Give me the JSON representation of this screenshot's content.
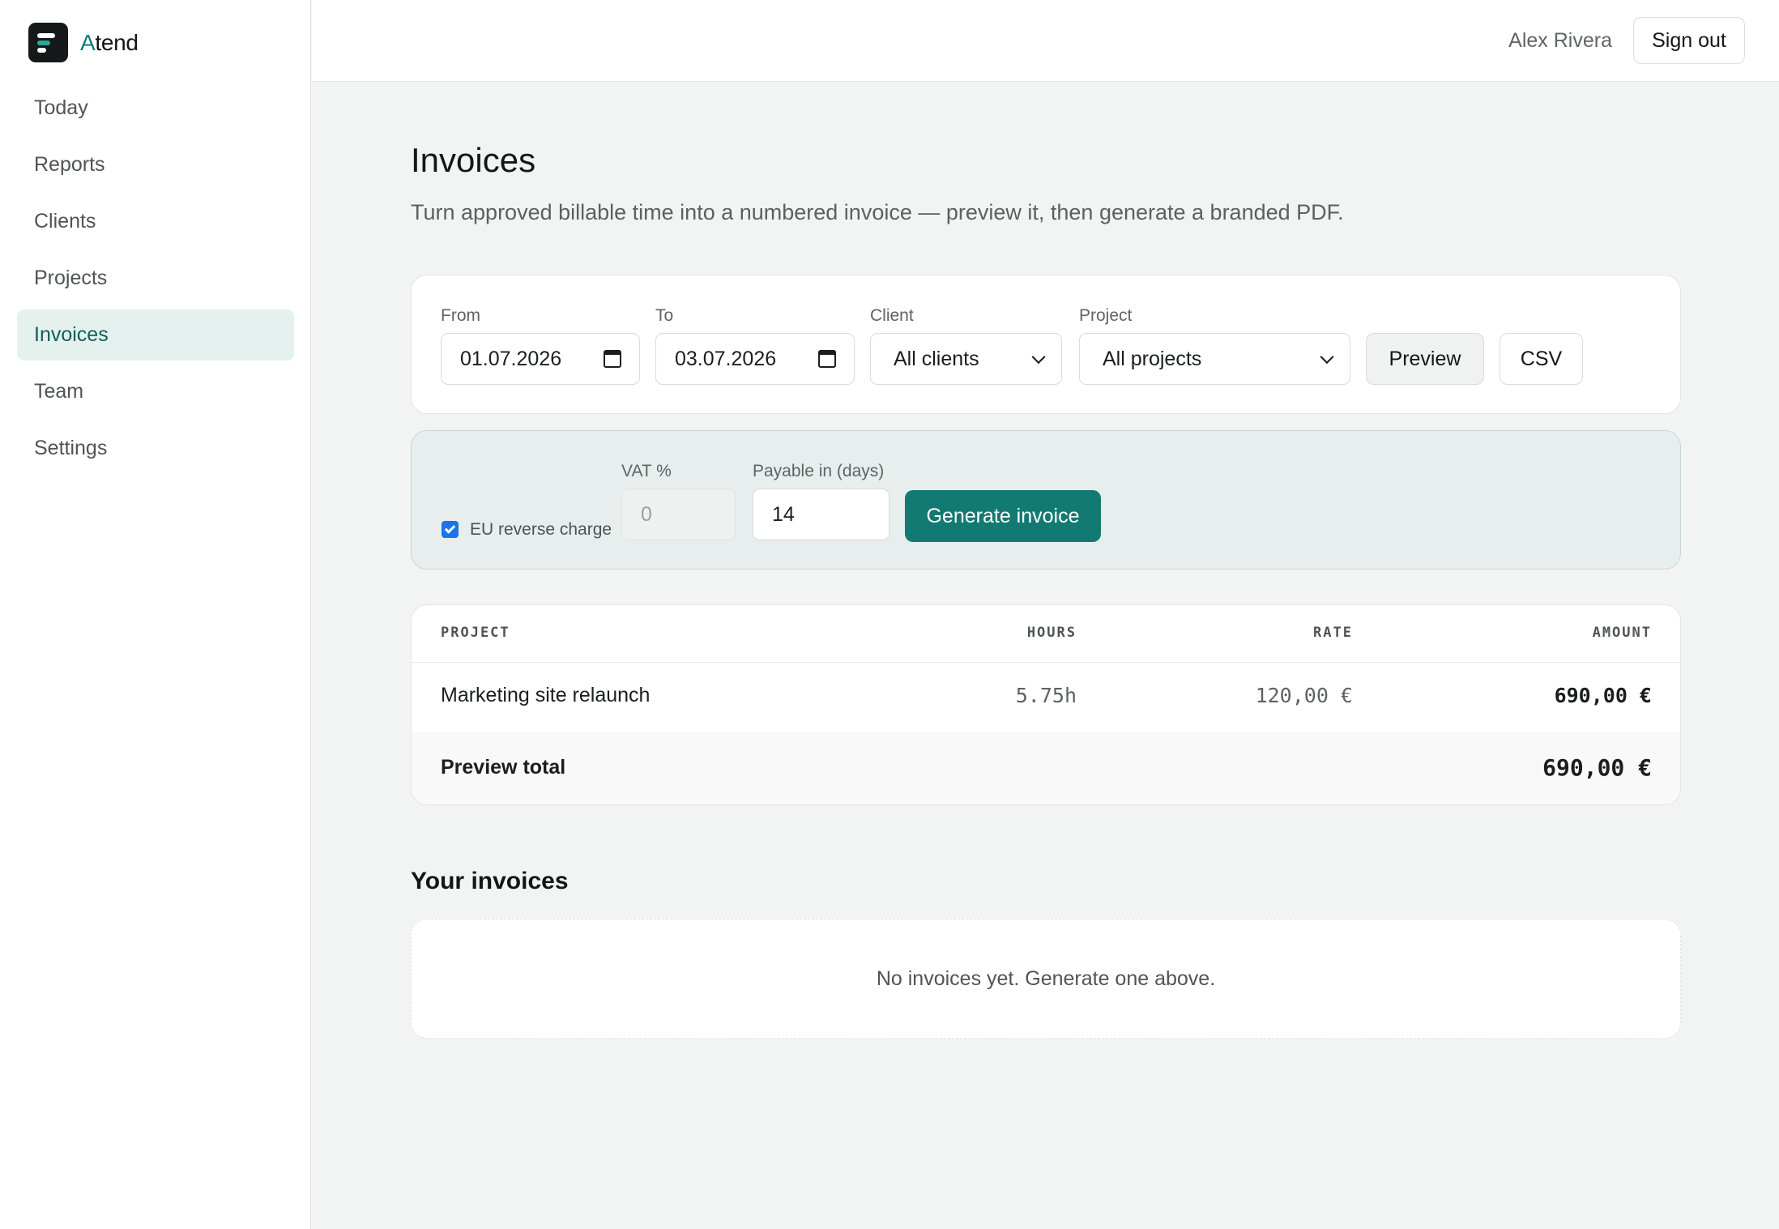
{
  "brand": {
    "name_initial": "A",
    "name_rest": "tend"
  },
  "sidebar": {
    "items": [
      {
        "label": "Today"
      },
      {
        "label": "Reports"
      },
      {
        "label": "Clients"
      },
      {
        "label": "Projects"
      },
      {
        "label": "Invoices",
        "active": true
      },
      {
        "label": "Team"
      },
      {
        "label": "Settings"
      }
    ]
  },
  "header": {
    "user_name": "Alex Rivera",
    "signout_label": "Sign out"
  },
  "page": {
    "title": "Invoices",
    "subtitle": "Turn approved billable time into a numbered invoice — preview it, then generate a branded PDF."
  },
  "filters": {
    "from_label": "From",
    "from_value": "01.07.2026",
    "to_label": "To",
    "to_value": "03.07.2026",
    "client_label": "Client",
    "client_value": "All clients",
    "project_label": "Project",
    "project_value": "All projects",
    "preview_label": "Preview",
    "csv_label": "CSV"
  },
  "generate": {
    "reverse_charge_label": "EU reverse charge",
    "reverse_charge_checked": true,
    "vat_label": "VAT %",
    "vat_placeholder": "0",
    "payable_label": "Payable in (days)",
    "payable_value": "14",
    "generate_label": "Generate invoice"
  },
  "preview_table": {
    "headers": [
      "PROJECT",
      "HOURS",
      "RATE",
      "AMOUNT"
    ],
    "rows": [
      {
        "project": "Marketing site relaunch",
        "hours": "5.75h",
        "rate": "120,00 €",
        "amount": "690,00 €"
      }
    ],
    "total_label": "Preview total",
    "total_value": "690,00 €"
  },
  "invoices_section": {
    "title": "Your invoices",
    "empty_text": "No invoices yet. Generate one above."
  },
  "colors": {
    "accent": "#137a73",
    "active_nav_bg": "#e5f1ef",
    "generate_panel_bg": "#e8eeed",
    "checkbox": "#1a73e8"
  },
  "icons": [
    "calendar-icon",
    "chevron-down-icon",
    "checkmark-icon",
    "logo-icon"
  ]
}
